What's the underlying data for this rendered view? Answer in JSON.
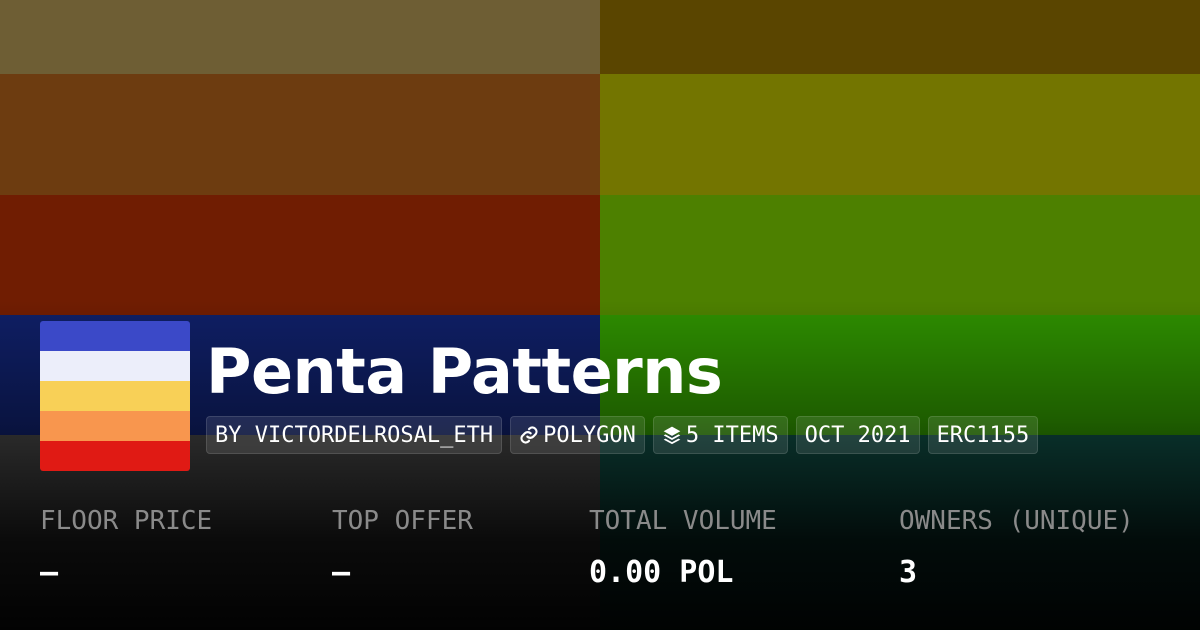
{
  "background": {
    "left_column": [
      "#6e5e34",
      "#6d3c10",
      "#701d02",
      "#0f1f66",
      "#474747"
    ],
    "right_column": [
      "#5a4500",
      "#737500",
      "#4d8000",
      "#2e8f00",
      "#0f4f45"
    ]
  },
  "logo": {
    "stripes": [
      "#3b49c8",
      "#eceefa",
      "#f8d057",
      "#f8964e",
      "#e01a14"
    ]
  },
  "collection": {
    "title": "Penta Patterns"
  },
  "chips": [
    {
      "label": "BY VICTORDELROSAL_ETH",
      "icon": ""
    },
    {
      "label": "POLYGON",
      "icon": "link-icon"
    },
    {
      "label": "5 ITEMS",
      "icon": "layers-icon"
    },
    {
      "label": "OCT 2021",
      "icon": ""
    },
    {
      "label": "ERC1155",
      "icon": ""
    }
  ],
  "stats": [
    {
      "label": "FLOOR PRICE",
      "value": "–"
    },
    {
      "label": "TOP OFFER",
      "value": "–"
    },
    {
      "label": "TOTAL VOLUME",
      "value": "0.00 POL"
    },
    {
      "label": "OWNERS (UNIQUE)",
      "value": "3"
    }
  ]
}
